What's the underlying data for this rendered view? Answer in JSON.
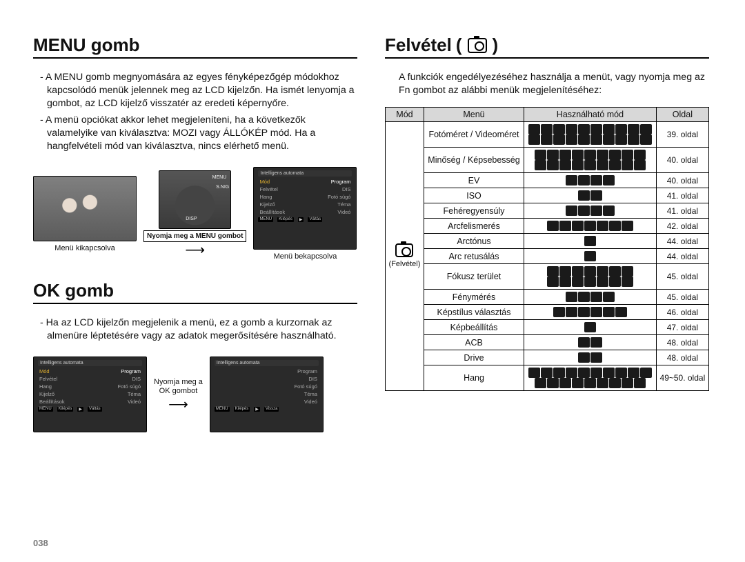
{
  "page_number": "038",
  "left": {
    "menu_heading": "MENU gomb",
    "menu_p1": "- A MENU gomb megnyomására az egyes fényképezőgép módokhoz kapcsolódó menük jelennek meg az LCD kijelzőn. Ha ismét lenyomja a gombot, az LCD kijelző visszatér az eredeti képernyőre.",
    "menu_p2": "- A menü opciókat akkor lehet megjeleníteni, ha a következők valamelyike van kiválasztva: MOZI vagy ÁLLÓKÉP mód. Ha a hangfelvételi mód van kiválasztva, nincs elérhető menü.",
    "fig_caption_off": "Menü kikapcsolva",
    "fig_caption_on": "Menü bekapcsolva",
    "fig_press_menu": "Nyomja meg a MENU gombot",
    "ctl_menu_label": "MENU",
    "ctl_snight_label": "S.NIG",
    "ctl_disp_label": "DISP",
    "ok_heading": "OK gomb",
    "ok_p1": "- Ha az LCD kijelzőn megjelenik a menü, ez a gomb a kurzornak az almenüre léptetésére vagy az adatok megerősítésére használható.",
    "fig_press_ok_l1": "Nyomja meg a",
    "fig_press_ok_l2": "OK gombot",
    "menu_panel": {
      "hdr": "Intelligens automata",
      "items_left": [
        "Mód",
        "Felvétel",
        "Hang",
        "Kijelző",
        "Beállítások"
      ],
      "items_right": [
        "Program",
        "DIS",
        "Fotó súgó",
        "Téma",
        "Videó"
      ],
      "ftr_left_key": "MENU",
      "ftr_left": "Kilépés",
      "ftr_right_key": "▶",
      "ftr_right": "Váltás",
      "ftr_right2": "Vissza"
    }
  },
  "right": {
    "heading": "Felvétel",
    "intro": "A funkciók engedélyezéséhez használja a menüt, vagy nyomja meg az Fn gombot az alábbi menük megjelenítéséhez:",
    "th_mode": "Mód",
    "th_menu": "Menü",
    "th_avail": "Használható mód",
    "th_page": "Oldal",
    "mode_label": "(Felvétel)",
    "rows": [
      {
        "menu": "Fotóméret / Videoméret",
        "page": "39. oldal",
        "mode_rows": [
          10,
          10
        ]
      },
      {
        "menu": "Minőség / Képsebesség",
        "page": "40. oldal",
        "mode_rows": [
          9,
          9
        ]
      },
      {
        "menu": "EV",
        "page": "40. oldal",
        "mode_rows": [
          4
        ]
      },
      {
        "menu": "ISO",
        "page": "41. oldal",
        "mode_rows": [
          2
        ]
      },
      {
        "menu": "Fehéregyensúly",
        "page": "41. oldal",
        "mode_rows": [
          4
        ]
      },
      {
        "menu": "Arcfelismerés",
        "page": "42. oldal",
        "mode_rows": [
          7
        ]
      },
      {
        "menu": "Arctónus",
        "page": "44. oldal",
        "mode_rows": [
          1
        ]
      },
      {
        "menu": "Arc retusálás",
        "page": "44. oldal",
        "mode_rows": [
          1
        ]
      },
      {
        "menu": "Fókusz terület",
        "page": "45. oldal",
        "mode_rows": [
          7,
          7
        ]
      },
      {
        "menu": "Fénymérés",
        "page": "45. oldal",
        "mode_rows": [
          4
        ]
      },
      {
        "menu": "Képstílus választás",
        "page": "46. oldal",
        "mode_rows": [
          6
        ]
      },
      {
        "menu": "Képbeállítás",
        "page": "47. oldal",
        "mode_rows": [
          1
        ]
      },
      {
        "menu": "ACB",
        "page": "48. oldal",
        "mode_rows": [
          2
        ]
      },
      {
        "menu": "Drive",
        "page": "48. oldal",
        "mode_rows": [
          2
        ]
      },
      {
        "menu": "Hang",
        "page": "49~50. oldal",
        "mode_rows": [
          10,
          9
        ]
      }
    ]
  }
}
